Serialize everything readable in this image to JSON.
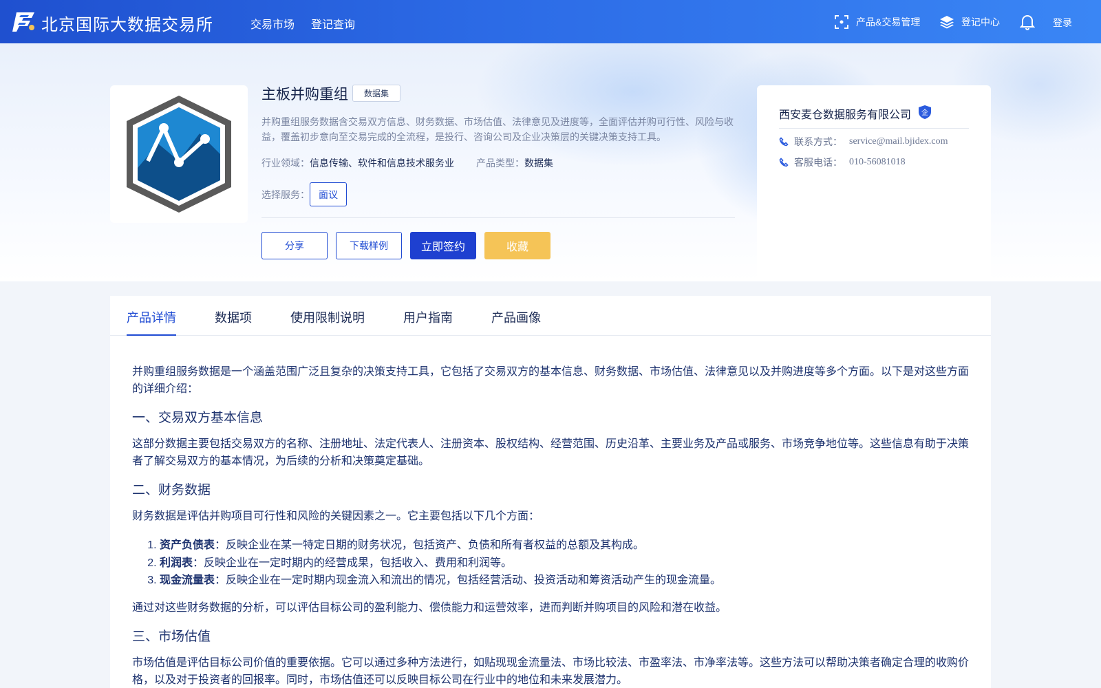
{
  "header": {
    "site_title": "北京国际大数据交易所",
    "nav": [
      "交易市场",
      "登记查询"
    ],
    "product_mgmt": "产品&交易管理",
    "registry_center": "登记中心",
    "login": "登录"
  },
  "product": {
    "title": "主板并购重组",
    "type_badge": "数据集",
    "description": "并购重组服务数据含交易双方信息、财务数据、市场估值、法律意见及进度等，全面评估并购可行性、风险与收益，覆盖初步意向至交易完成的全流程，是投行、咨询公司及企业决策层的关键决策支持工具。",
    "industry_label": "行业领域：",
    "industry_value": "信息传输、软件和信息技术服务业",
    "ptype_label": "产品类型：",
    "ptype_value": "数据集",
    "service_label": "选择服务：",
    "service_option": "面议",
    "buttons": {
      "share": "分享",
      "download_sample": "下载样例",
      "sign_now": "立即签约",
      "favorite": "收藏"
    }
  },
  "company": {
    "name": "西安麦仓数据服务有限公司",
    "badge": "企",
    "contact_label": "联系方式：",
    "contact_value": "service@mail.bjidex.com",
    "phone_label": "客服电话：",
    "phone_value": "010-56081018"
  },
  "tabs": [
    "产品详情",
    "数据项",
    "使用限制说明",
    "用户指南",
    "产品画像"
  ],
  "detail": {
    "intro": "并购重组服务数据是一个涵盖范围广泛且复杂的决策支持工具，它包括了交易双方的基本信息、财务数据、市场估值、法律意见以及并购进度等多个方面。以下是对这些方面的详细介绍：",
    "s1_title": "一、交易双方基本信息",
    "s1_body": "这部分数据主要包括交易双方的名称、注册地址、法定代表人、注册资本、股权结构、经营范围、历史沿革、主要业务及产品或服务、市场竞争地位等。这些信息有助于决策者了解交易双方的基本情况，为后续的分析和决策奠定基础。",
    "s2_title": "二、财务数据",
    "s2_body": "财务数据是评估并购项目可行性和风险的关键因素之一。它主要包括以下几个方面：",
    "s2_items": [
      {
        "term": "资产负债表",
        "text": "：反映企业在某一特定日期的财务状况，包括资产、负债和所有者权益的总额及其构成。"
      },
      {
        "term": "利润表",
        "text": "：反映企业在一定时期内的经营成果，包括收入、费用和利润等。"
      },
      {
        "term": "现金流量表",
        "text": "：反映企业在一定时期内现金流入和流出的情况，包括经营活动、投资活动和筹资活动产生的现金流量。"
      }
    ],
    "s2_summary": "通过对这些财务数据的分析，可以评估目标公司的盈利能力、偿债能力和运营效率，进而判断并购项目的风险和潜在收益。",
    "s3_title": "三、市场估值",
    "s3_body": "市场估值是评估目标公司价值的重要依据。它可以通过多种方法进行，如贴现现金流量法、市场比较法、市盈率法、市净率法等。这些方法可以帮助决策者确定合理的收购价格，以及对于投资者的回报率。同时，市场估值还可以反映目标公司在行业中的地位和未来发展潜力。"
  }
}
